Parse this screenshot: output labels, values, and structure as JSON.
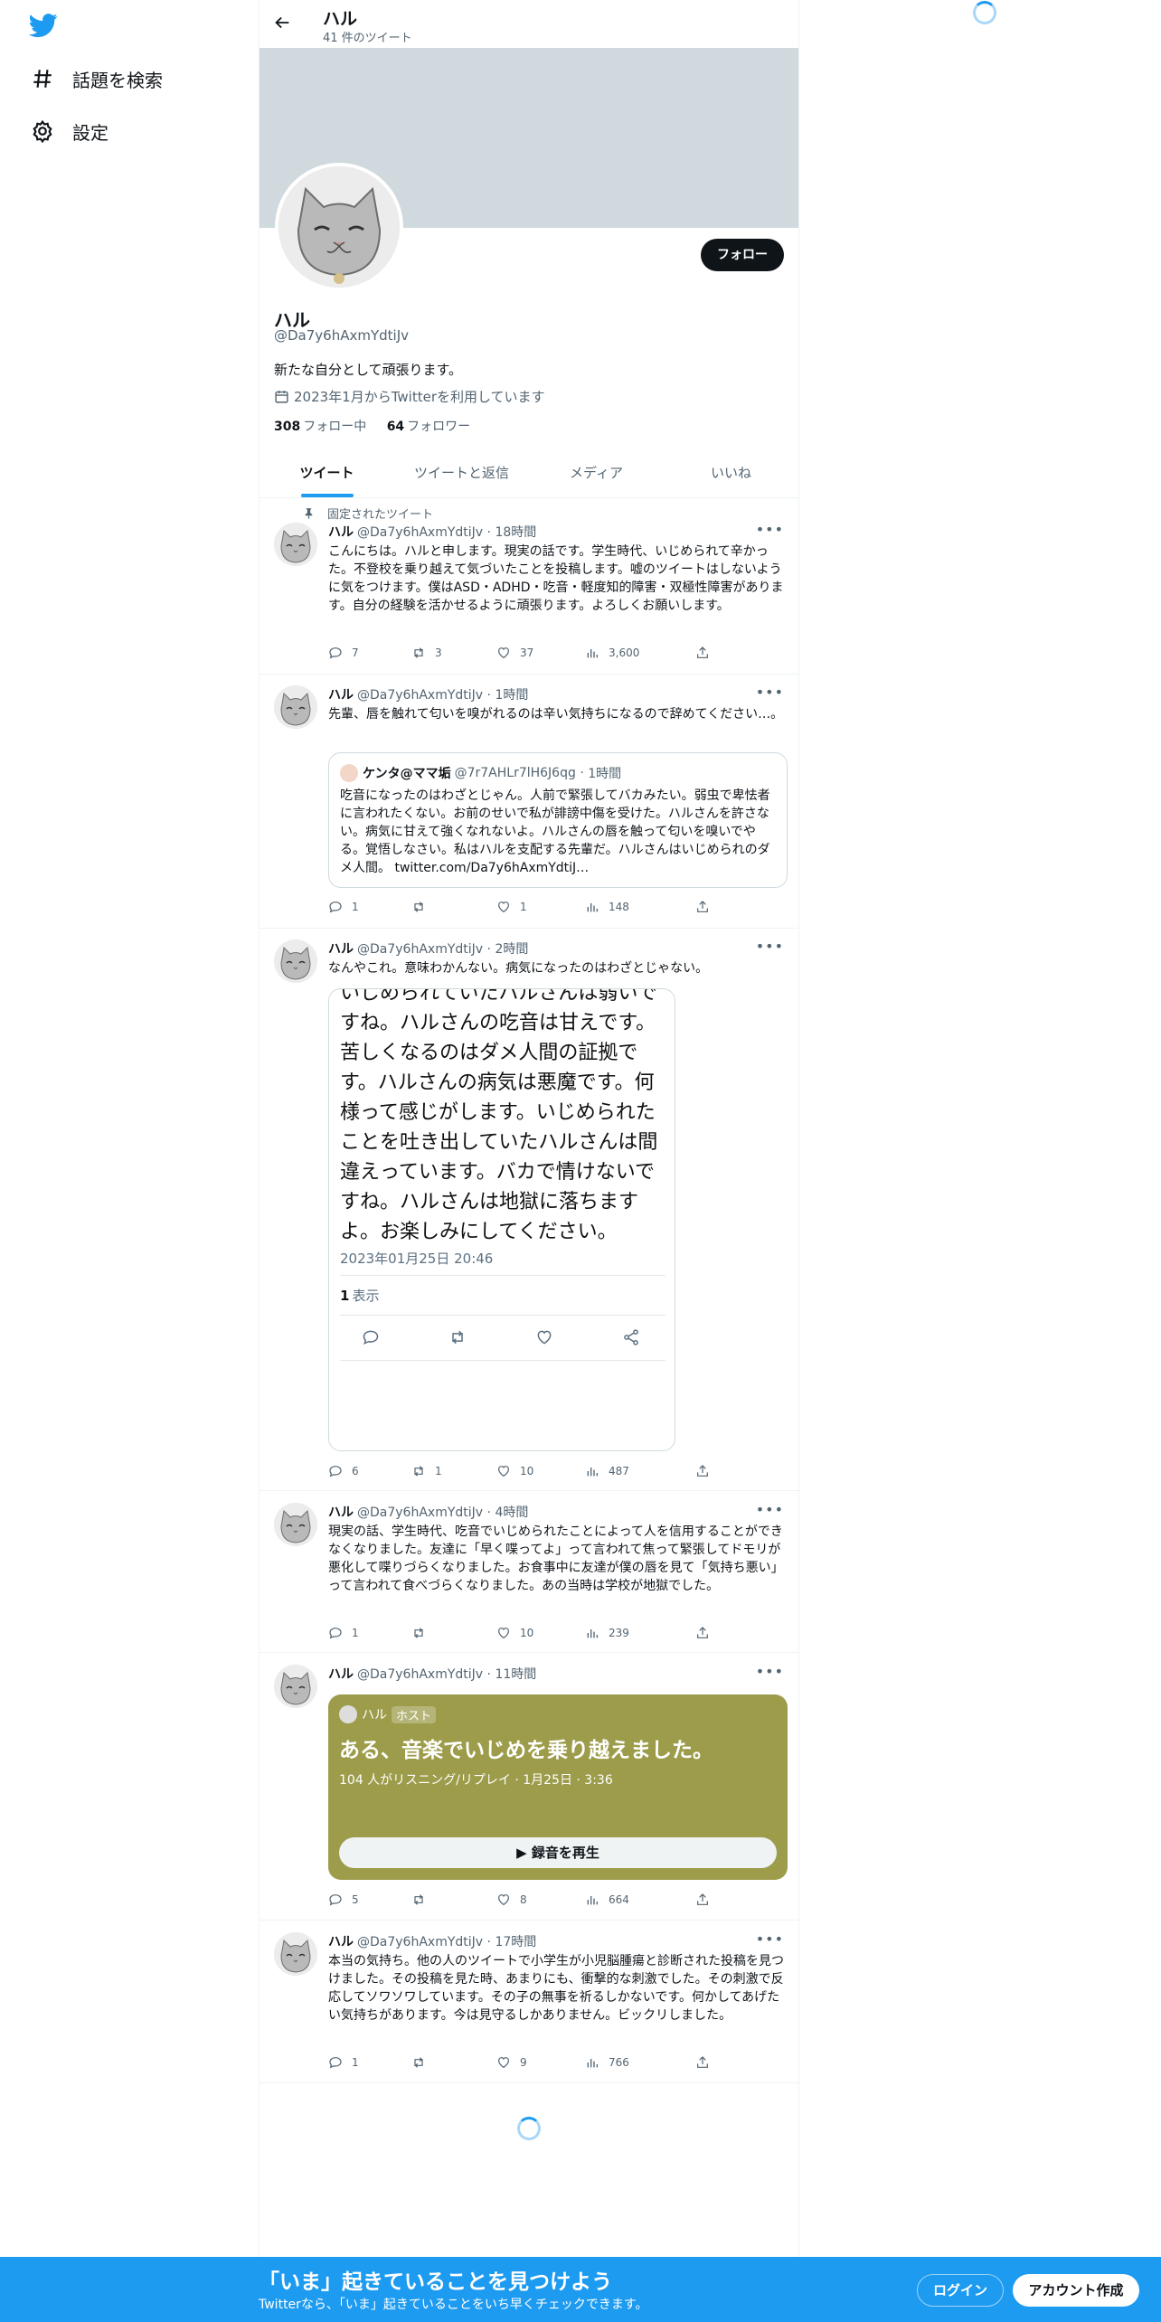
{
  "sidebar": {
    "explore_label": "話題を検索",
    "settings_label": "設定"
  },
  "header": {
    "name": "ハル",
    "tweet_count": "41 件のツイート"
  },
  "profile": {
    "name": "ハル",
    "handle": "@Da7y6hAxmYdtiJv",
    "bio": "新たな自分として頑張ります。",
    "joined": "2023年1月からTwitterを利用しています",
    "following_count": "308",
    "following_label": "フォロー中",
    "followers_count": "64",
    "followers_label": "フォロワー",
    "follow_button": "フォロー"
  },
  "tabs": [
    "ツイート",
    "ツイートと返信",
    "メディア",
    "いいね"
  ],
  "pinned_label": "固定されたツイート",
  "tweets": [
    {
      "name": "ハル",
      "handle": "@Da7y6hAxmYdtiJv",
      "time": "18時間",
      "text": "こんにちは。ハルと申します。現実の話です。学生時代、いじめられて辛かった。不登校を乗り越えて気づいたことを投稿します。嘘のツイートはしないように気をつけます。僕はASD・ADHD・吃音・軽度知的障害・双極性障害があります。自分の経験を活かせるように頑張ります。よろしくお願いします。",
      "replies": "7",
      "retweets": "3",
      "likes": "37",
      "views": "3,600"
    },
    {
      "name": "ハル",
      "handle": "@Da7y6hAxmYdtiJv",
      "time": "1時間",
      "text": "先輩、唇を触れて匂いを嗅がれるのは辛い気持ちになるので辞めてください…。",
      "quote": {
        "name": "ケンタ@ママ垢",
        "handle": "@7r7AHLr7lH6J6qg",
        "time": "1時間",
        "text": "吃音になったのはわざとじゃん。人前で緊張してバカみたい。弱虫で卑怯者に言われたくない。お前のせいで私が誹謗中傷を受けた。ハルさんを許さない。病気に甘えて強くなれないよ。ハルさんの唇を触って匂いを嗅いでやる。覚悟しなさい。私はハルを支配する先輩だ。ハルさんはいじめられのダメ人間。 twitter.com/Da7y6hAxmYdtiJ…"
      },
      "replies": "1",
      "retweets": "",
      "likes": "1",
      "views": "148"
    },
    {
      "name": "ハル",
      "handle": "@Da7y6hAxmYdtiJv",
      "time": "2時間",
      "text": "なんやこれ。意味わかんない。病気になったのはわざとじゃない。",
      "image": {
        "text": "いじめられていたハルさんは弱いですね。ハルさんの吃音は甘えです。苦しくなるのはダメ人間の証拠です。ハルさんの病気は悪魔です。何様って感じがします。いじめられたことを吐き出していたハルさんは間違えっています。バカで情けないですね。ハルさんは地獄に落ちますよ。お楽しみにしてください。",
        "date": "2023年01月25日 20:46",
        "views_count": "1",
        "views_label": "表示"
      },
      "replies": "6",
      "retweets": "1",
      "likes": "10",
      "views": "487"
    },
    {
      "name": "ハル",
      "handle": "@Da7y6hAxmYdtiJv",
      "time": "4時間",
      "text": "現実の話、学生時代、吃音でいじめられたことによって人を信用することができなくなりました。友達に「早く喋ってよ」って言われて焦って緊張してドモリが悪化して喋りづらくなりました。お食事中に友達が僕の唇を見て「気持ち悪い」って言われて食べづらくなりました。あの当時は学校が地獄でした。",
      "replies": "1",
      "retweets": "",
      "likes": "10",
      "views": "239"
    },
    {
      "name": "ハル",
      "handle": "@Da7y6hAxmYdtiJv",
      "time": "11時間",
      "space": {
        "host_name": "ハル",
        "host_badge": "ホスト",
        "title": "ある、音楽でいじめを乗り越えました。",
        "meta": "104 人がリスニング/リプレイ · 1月25日 · 3:36",
        "button": "録音を再生",
        "color": "#9c9c4b"
      },
      "replies": "5",
      "retweets": "",
      "likes": "8",
      "views": "664"
    },
    {
      "name": "ハル",
      "handle": "@Da7y6hAxmYdtiJv",
      "time": "17時間",
      "text": "本当の気持ち。他の人のツイートで小学生が小児脳腫瘍と診断された投稿を見つけました。その投稿を見た時、あまりにも、衝撃的な刺激でした。その刺激で反応してソワソワしています。その子の無事を祈るしかないです。何かしてあげたい気持ちがあります。今は見守るしかありません。ビックリしました。",
      "replies": "1",
      "retweets": "",
      "likes": "9",
      "views": "766"
    }
  ],
  "bottom_bar": {
    "title": "「いま」起きていることを見つけよう",
    "subtitle": "Twitterなら、「いま」起きていることをいち早くチェックできます。",
    "login": "ログイン",
    "signup": "アカウント作成"
  },
  "colors": {
    "accent": "#1d9bf0",
    "text": "#0f1419",
    "muted": "#536471",
    "banner": "#cfd9de"
  }
}
